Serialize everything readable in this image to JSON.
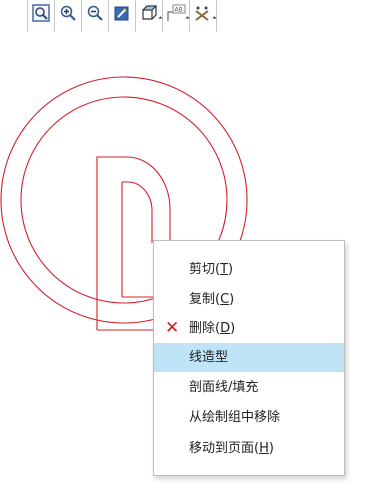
{
  "toolbar": {
    "buttons": [
      {
        "icon": "zoom-window-icon"
      },
      {
        "icon": "zoom-in-icon"
      },
      {
        "icon": "zoom-out-icon"
      },
      {
        "icon": "edit-sketch-icon"
      },
      {
        "icon": "view-orientation-icon"
      },
      {
        "icon": "annotation-abc-icon"
      },
      {
        "icon": "hide-show-icon"
      }
    ]
  },
  "context_menu": {
    "items": [
      {
        "label_main": "剪切(",
        "label_key": "T",
        "label_end": ")"
      },
      {
        "label_main": "复制(",
        "label_key": "C",
        "label_end": ")"
      },
      {
        "label_main": "删除(",
        "label_key": "D",
        "label_end": ")"
      },
      {
        "label_main": "线造型",
        "label_key": "",
        "label_end": ""
      },
      {
        "label_main": "剖面线/填充",
        "label_key": "",
        "label_end": ""
      },
      {
        "label_main": "从绘制组中移除",
        "label_key": "",
        "label_end": ""
      },
      {
        "label_main": "移动到页面(",
        "label_key": "H",
        "label_end": ")"
      }
    ]
  },
  "colors": {
    "sketch_line": "#d2202a",
    "menu_highlight": "#bfe4f8",
    "delete_icon": "#d11b1b"
  }
}
